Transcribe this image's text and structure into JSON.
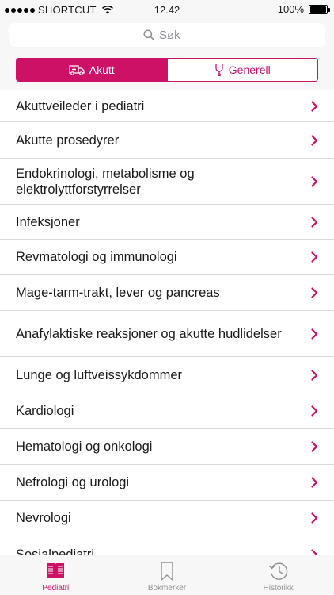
{
  "status_bar": {
    "carrier": "SHORTCUT",
    "time": "12.42",
    "battery": "100%",
    "battery_level": 1.0
  },
  "search": {
    "placeholder": "Søk"
  },
  "segments": [
    {
      "label": "Akutt",
      "icon": "ambulance-icon",
      "active": true
    },
    {
      "label": "Generell",
      "icon": "stethoscope-icon",
      "active": false
    }
  ],
  "list": {
    "items": [
      {
        "line1": "Akuttveileder i pediatri",
        "line2": ""
      },
      {
        "line1": "Akutte prosedyrer",
        "line2": ""
      },
      {
        "line1": "Endokrinologi, metabolisme og",
        "line2": "elektrolyttforstyrrelser"
      },
      {
        "line1": "Infeksjoner",
        "line2": ""
      },
      {
        "line1": "Revmatologi og immunologi",
        "line2": ""
      },
      {
        "line1": "Mage-tarm-trakt, lever og pancreas",
        "line2": ""
      },
      {
        "line1": "Anafylaktiske reaksjoner og akutte hudlidelser",
        "line2": ""
      },
      {
        "line1": "Lunge og luftveissykdommer",
        "line2": ""
      },
      {
        "line1": "Kardiologi",
        "line2": ""
      },
      {
        "line1": "Hematologi og onkologi",
        "line2": ""
      },
      {
        "line1": "Nefrologi og urologi",
        "line2": ""
      },
      {
        "line1": "Nevrologi",
        "line2": ""
      },
      {
        "line1": "Sosialpediatri",
        "line2": ""
      }
    ]
  },
  "tab_bar": {
    "tabs": [
      {
        "label": "Pediatri",
        "icon": "book-icon",
        "active": true
      },
      {
        "label": "Bokmerker",
        "icon": "bookmark-icon",
        "active": false
      },
      {
        "label": "Historikk",
        "icon": "history-icon",
        "active": false
      }
    ]
  },
  "colors": {
    "accent": "#cc1166",
    "inactive_tab": "#929292",
    "bar_background": "#f7f7f7"
  }
}
